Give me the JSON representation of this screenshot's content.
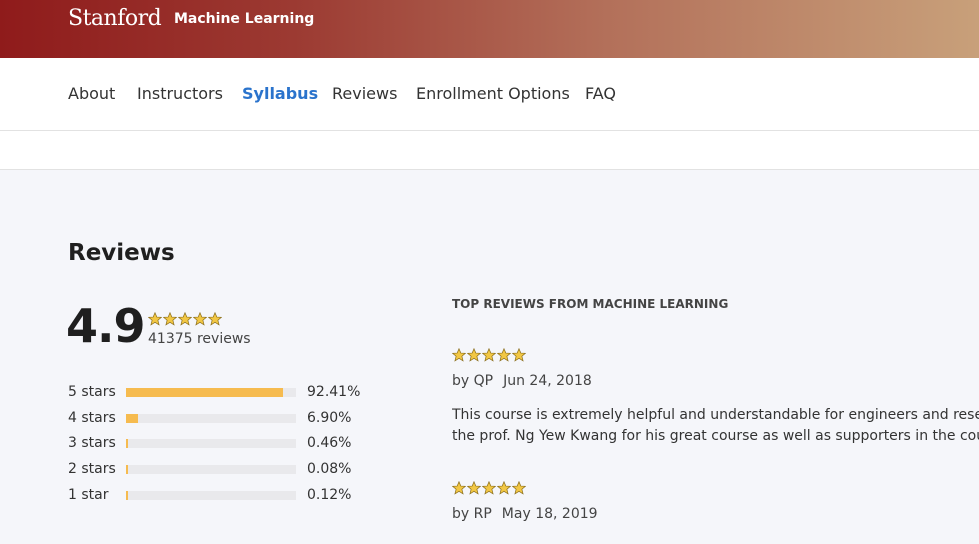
{
  "header": {
    "brand": "Stanford",
    "subtitle": "Machine Learning"
  },
  "nav": {
    "items": [
      {
        "label": "About"
      },
      {
        "label": "Instructors"
      },
      {
        "label": "Syllabus",
        "active": true
      },
      {
        "label": "Reviews"
      },
      {
        "label": "Enrollment Options"
      },
      {
        "label": "FAQ"
      }
    ]
  },
  "reviews": {
    "title": "Reviews",
    "rating": "4.9",
    "rating_stars": 5,
    "count_text": "41375 reviews",
    "distribution": [
      {
        "label": "5 stars",
        "pct": "92.41%",
        "fraction": 0.9241
      },
      {
        "label": "4 stars",
        "pct": "6.90%",
        "fraction": 0.069
      },
      {
        "label": "3 stars",
        "pct": "0.46%",
        "fraction": 0.0046
      },
      {
        "label": "2 stars",
        "pct": "0.08%",
        "fraction": 0.0008
      },
      {
        "label": "1 star",
        "pct": "0.12%",
        "fraction": 0.0012
      }
    ]
  },
  "top_reviews": {
    "title": "TOP REVIEWS FROM MACHINE LEARNING",
    "items": [
      {
        "stars": 5,
        "by": "by QP",
        "date": "Jun 24, 2018",
        "lines": [
          "This course is extremely helpful and understandable for engineers and researche",
          "the prof. Ng Yew Kwang for his great course as well as supporters in the course fo"
        ]
      },
      {
        "stars": 5,
        "by": "by RP",
        "date": "May 18, 2019"
      }
    ]
  },
  "colors": {
    "accent": "#2a73cc",
    "star": "#f2c744",
    "bar": "#f6bb4f",
    "banner_start": "#8f1b1b",
    "banner_end": "#c8a07a"
  }
}
